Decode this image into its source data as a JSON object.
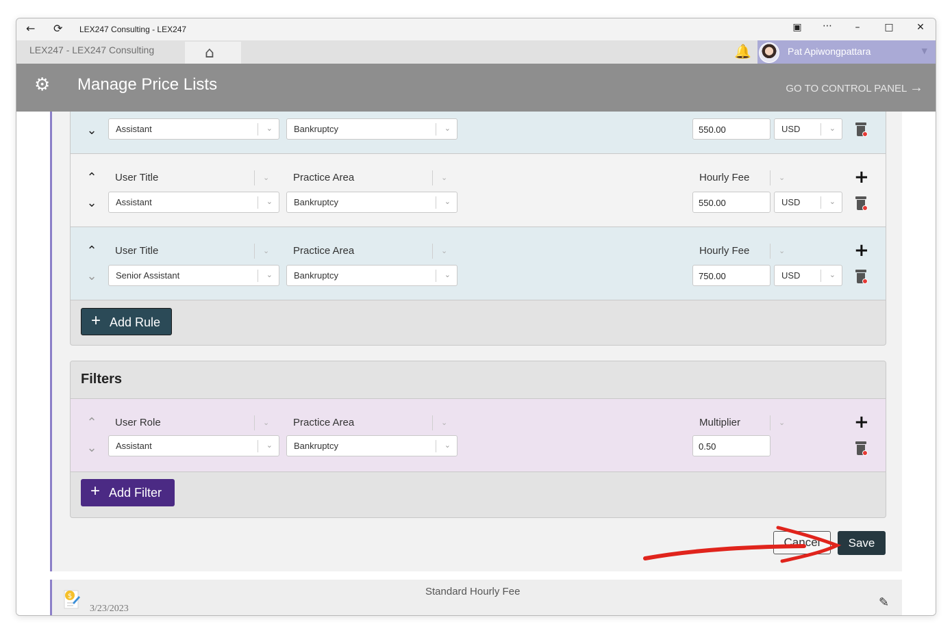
{
  "window": {
    "title": "LEX247 Consulting - LEX247",
    "back_icon": "back-arrow-icon",
    "refresh_icon": "refresh-icon"
  },
  "appbar": {
    "breadcrumb": "LEX247   -  LEX247 Consulting",
    "user_name": "Pat Apiwongpattara"
  },
  "header": {
    "title": "Manage Price Lists",
    "control_panel_link": "GO TO CONTROL PANEL"
  },
  "rules": [
    {
      "show_header": false,
      "bg": "#e1ecf0",
      "user_title": "Assistant",
      "practice_area": "Bankruptcy",
      "hourly_fee": "550.00",
      "currency": "USD"
    },
    {
      "show_header": true,
      "bg": "#f3f3f3",
      "labels": {
        "user_title": "User Title",
        "practice_area": "Practice Area",
        "hourly_fee": "Hourly Fee"
      },
      "user_title": "Assistant",
      "practice_area": "Bankruptcy",
      "hourly_fee": "550.00",
      "currency": "USD"
    },
    {
      "show_header": true,
      "bg": "#e1ecf0",
      "labels": {
        "user_title": "User Title",
        "practice_area": "Practice Area",
        "hourly_fee": "Hourly Fee"
      },
      "user_title": "Senior Assistant",
      "practice_area": "Bankruptcy",
      "hourly_fee": "750.00",
      "currency": "USD"
    }
  ],
  "add_rule_label": "Add Rule",
  "filters": {
    "title": "Filters",
    "labels": {
      "user_role": "User Role",
      "practice_area": "Practice Area",
      "multiplier": "Multiplier"
    },
    "user_role": "Assistant",
    "practice_area": "Bankruptcy",
    "multiplier": "0.50",
    "add_filter_label": "Add Filter"
  },
  "actions": {
    "cancel_label": "Cancel",
    "save_label": "Save",
    "annotation_color": "#e0241c"
  },
  "price_list_item": {
    "name": "Standard Hourly Fee",
    "date": "3/23/2023"
  }
}
